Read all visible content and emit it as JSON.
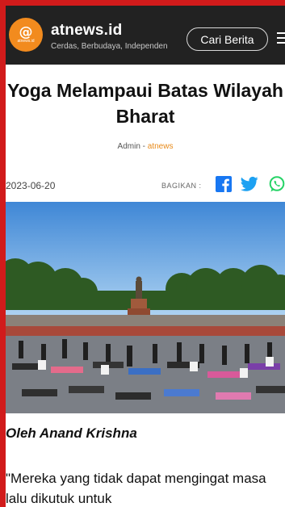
{
  "header": {
    "logo_mark": "@",
    "logo_text": "atnews.id",
    "site_name": "atnews.id",
    "tagline": "Cerdas, Berbudaya, Independen",
    "search_label": "Cari Berita"
  },
  "article": {
    "title": "Yoga Melampaui Batas Wilayah Bharat",
    "byline_role": "Admin",
    "byline_sep": " - ",
    "byline_source": "atnews",
    "date": "2023-06-20",
    "share_label": "BAGIKAN :",
    "author_line": "Oleh Anand Krishna",
    "body_text": "\"Mereka yang tidak dapat mengingat masa lalu dikutuk untuk"
  },
  "icons": {
    "menu": "hamburger-menu-icon",
    "facebook": "facebook-icon",
    "twitter": "twitter-icon",
    "whatsapp": "whatsapp-icon"
  },
  "colors": {
    "border": "#d11b1b",
    "header_bg": "#222222",
    "logo": "#f28b1e",
    "accent": "#e88a1a",
    "facebook": "#1877f2",
    "twitter": "#1da1f2",
    "whatsapp": "#25d366"
  }
}
